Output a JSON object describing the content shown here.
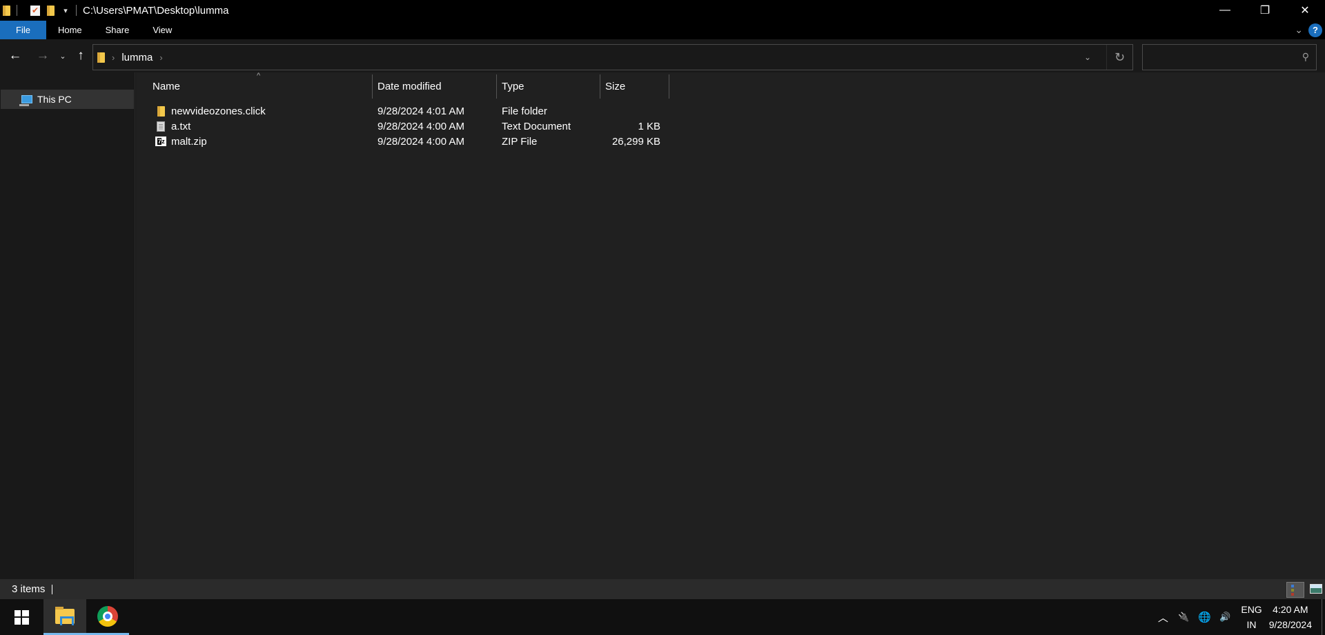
{
  "window": {
    "title": "C:\\Users\\PMAT\\Desktop\\lumma",
    "controls": {
      "minimize": "—",
      "restore": "❐",
      "close": "✕"
    }
  },
  "quick_access": {
    "dropdown_glyph": "▾"
  },
  "ribbon": {
    "tabs": [
      {
        "label": "File",
        "active": true
      },
      {
        "label": "Home"
      },
      {
        "label": "Share"
      },
      {
        "label": "View"
      }
    ],
    "expand_glyph": "⌄",
    "help_glyph": "?"
  },
  "navigation": {
    "back_glyph": "←",
    "forward_glyph": "→",
    "recent_glyph": "⌄",
    "up_glyph": "↑",
    "breadcrumb": [
      "lumma"
    ],
    "crumb_separator": "›",
    "address_dropdown_glyph": "⌄",
    "refresh_glyph": "↻",
    "search": {
      "value": "",
      "placeholder": "",
      "icon_glyph": "⚲"
    }
  },
  "nav_pane": {
    "items": [
      {
        "label": "This PC",
        "icon": "computer-icon",
        "selected": true
      }
    ]
  },
  "file_list": {
    "sort_glyph": "^",
    "columns": [
      {
        "key": "name",
        "label": "Name"
      },
      {
        "key": "date",
        "label": "Date modified"
      },
      {
        "key": "type",
        "label": "Type"
      },
      {
        "key": "size",
        "label": "Size"
      }
    ],
    "rows": [
      {
        "name": "newvideozones.click",
        "date": "9/28/2024 4:01 AM",
        "type": "File folder",
        "size": "",
        "icon": "folder-icon"
      },
      {
        "name": "a.txt",
        "date": "9/28/2024 4:00 AM",
        "type": "Text Document",
        "size": "1 KB",
        "icon": "text-file-icon"
      },
      {
        "name": "malt.zip",
        "date": "9/28/2024 4:00 AM",
        "type": "ZIP File",
        "size": "26,299 KB",
        "icon": "7zip-archive-icon"
      }
    ]
  },
  "status_bar": {
    "item_count": "3 items"
  },
  "taskbar": {
    "apps": [
      {
        "name": "File Explorer",
        "active": true
      },
      {
        "name": "Google Chrome",
        "active": false
      }
    ],
    "tray": {
      "chevron_glyph": "︿",
      "battery_glyph": "🔌",
      "network_glyph": "🌐",
      "volume_glyph": "🔊",
      "language_line1": "ENG",
      "language_line2": "IN",
      "time": "4:20 AM",
      "date": "9/28/2024"
    }
  },
  "colors": {
    "accent": "#1a6ebd",
    "folder": "#f3c84b",
    "content_bg": "#202020",
    "taskbar_active": "#76b9ed"
  }
}
